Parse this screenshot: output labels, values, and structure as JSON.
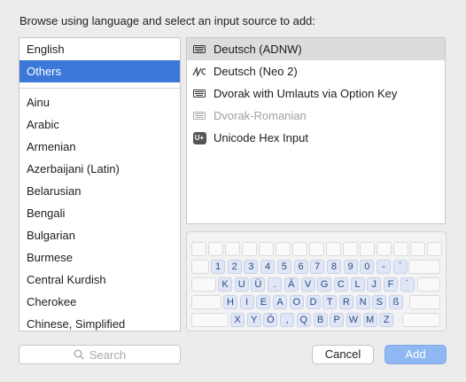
{
  "heading": "Browse using language and select an input source to add:",
  "languages": [
    {
      "label": "English",
      "selected": false
    },
    {
      "label": "Others",
      "selected": true
    },
    {
      "label": "Ainu",
      "selected": false
    },
    {
      "label": "Arabic",
      "selected": false
    },
    {
      "label": "Armenian",
      "selected": false
    },
    {
      "label": "Azerbaijani (Latin)",
      "selected": false
    },
    {
      "label": "Belarusian",
      "selected": false
    },
    {
      "label": "Bengali",
      "selected": false
    },
    {
      "label": "Bulgarian",
      "selected": false
    },
    {
      "label": "Burmese",
      "selected": false
    },
    {
      "label": "Central Kurdish",
      "selected": false
    },
    {
      "label": "Cherokee",
      "selected": false
    },
    {
      "label": "Chinese, Simplified",
      "selected": false
    }
  ],
  "sources": [
    {
      "label": "Deutsch (ADNW)",
      "icon": "keyboard-icon",
      "selected": true
    },
    {
      "label": "Deutsch (Neo 2)",
      "icon": "neo-icon",
      "selected": false
    },
    {
      "label": "Dvorak with Umlauts via Option Key",
      "icon": "keyboard-icon",
      "selected": false
    },
    {
      "label": "Dvorak-Romanian",
      "icon": "keyboard-icon",
      "selected": false,
      "disabled": true
    },
    {
      "label": "Unicode Hex Input",
      "icon": "unicode-badge-icon",
      "badge": "U+",
      "selected": false
    }
  ],
  "keyboard_preview": {
    "rows": [
      [
        "1",
        "2",
        "3",
        "4",
        "5",
        "6",
        "7",
        "8",
        "9",
        "0",
        "-",
        "`"
      ],
      [
        "K",
        "U",
        "Ü",
        ".",
        "Ä",
        "V",
        "G",
        "C",
        "L",
        "J",
        "F",
        "´"
      ],
      [
        "H",
        "I",
        "E",
        "A",
        "O",
        "D",
        "T",
        "R",
        "N",
        "S",
        "ß"
      ],
      [
        "X",
        "Y",
        "Ö",
        ",",
        "Q",
        "B",
        "P",
        "W",
        "M",
        "Z"
      ]
    ]
  },
  "search": {
    "placeholder": "Search"
  },
  "buttons": {
    "cancel": "Cancel",
    "add": "Add"
  },
  "colors": {
    "selection": "#3b78d8",
    "add_button": "#8fb7f1",
    "key_text": "#2c4b86"
  }
}
